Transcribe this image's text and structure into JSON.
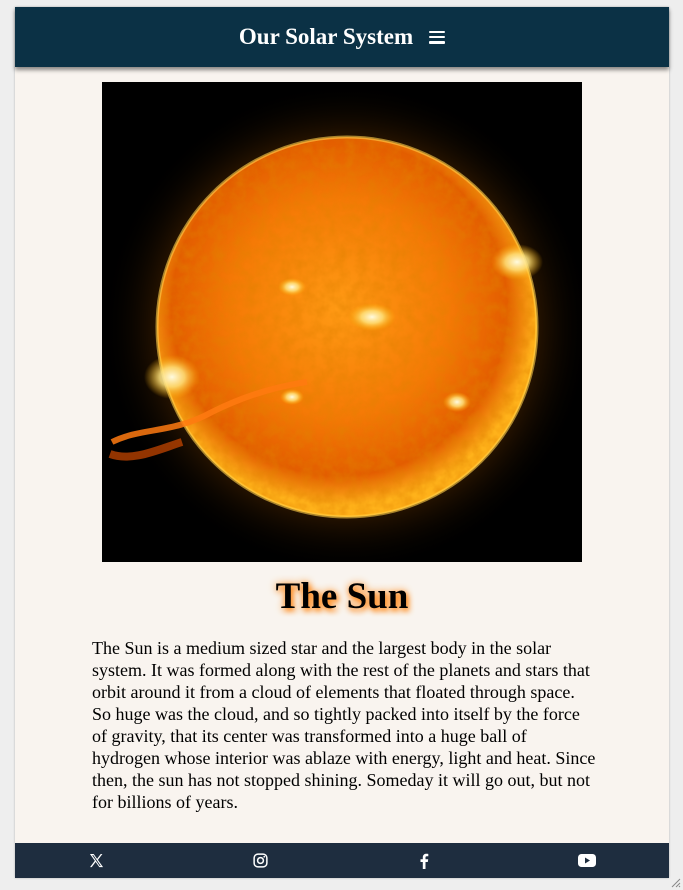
{
  "header": {
    "title": "Our Solar System",
    "menu_icon": "hamburger-menu-icon"
  },
  "hero": {
    "subject": "sun",
    "alt": "The Sun"
  },
  "article": {
    "title": "The Sun",
    "description": "The Sun is a medium sized star and the largest body in the solar system. It was formed along with the rest of the planets and stars that orbit around it from a cloud of elements that floated through space. So huge was the cloud, and so tightly packed into itself by the force of gravity, that its center was transformed into a huge ball of hydrogen whose interior was ablaze with energy, light and heat. Since then, the sun has not stopped shining. Someday it will go out, but not for billions of years."
  },
  "footer": {
    "links": [
      {
        "icon": "x-twitter-icon"
      },
      {
        "icon": "instagram-icon"
      },
      {
        "icon": "facebook-icon"
      },
      {
        "icon": "youtube-icon"
      }
    ]
  },
  "colors": {
    "header_bg": "#0b3145",
    "footer_bg": "#1e2d3f",
    "page_bg": "#f9f4ef",
    "title_glow": "#ff8a1c"
  }
}
